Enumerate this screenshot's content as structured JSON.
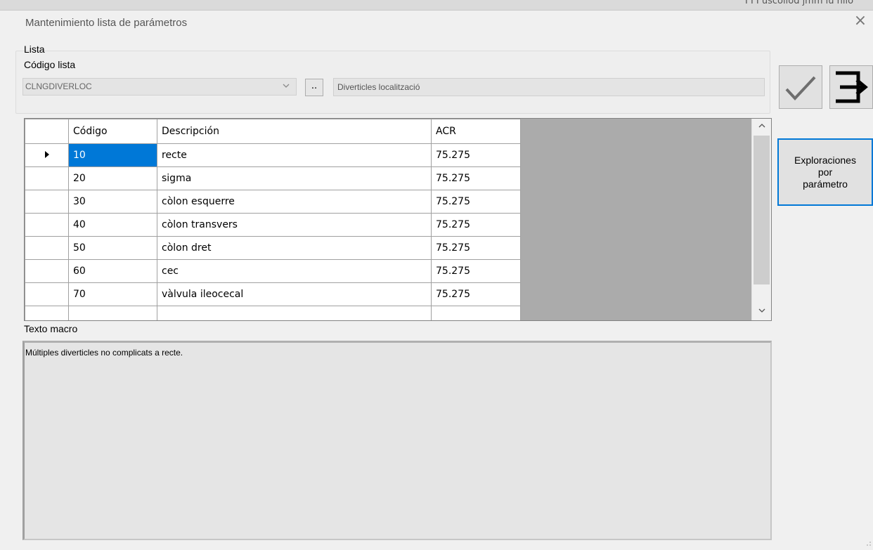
{
  "window": {
    "title": "Mantenimiento lista de parámetros",
    "close_label": "×",
    "background_text": "I I I uscollod jmm lu nilo"
  },
  "lista": {
    "group_label": "Lista",
    "codigo_label": "Código lista",
    "codigo_value": "CLNGDIVERLOC",
    "browse_label": "..",
    "descripcion_value": "Diverticles localització"
  },
  "buttons": {
    "accept_icon": "checkmark-icon",
    "exit_icon": "exit-arrow-icon",
    "exploraciones_line1": "Exploraciones",
    "exploraciones_line2": "por",
    "exploraciones_line3": "parámetro"
  },
  "grid": {
    "headers": [
      "",
      "Código",
      "Descripción",
      "ACR"
    ],
    "rows": [
      {
        "codigo": "10",
        "descripcion": "recte",
        "acr": "75.275"
      },
      {
        "codigo": "20",
        "descripcion": "sigma",
        "acr": "75.275"
      },
      {
        "codigo": "30",
        "descripcion": "còlon esquerre",
        "acr": "75.275"
      },
      {
        "codigo": "40",
        "descripcion": "còlon transvers",
        "acr": "75.275"
      },
      {
        "codigo": "50",
        "descripcion": "còlon dret",
        "acr": "75.275"
      },
      {
        "codigo": "60",
        "descripcion": "cec",
        "acr": "75.275"
      },
      {
        "codigo": "70",
        "descripcion": "vàlvula ileocecal",
        "acr": "75.275"
      }
    ],
    "selected_row": 0
  },
  "macro": {
    "label": "Texto macro",
    "text": "Múltiples diverticles no complicats a recte."
  },
  "colors": {
    "accent": "#0078d7",
    "window_bg": "#f0f0f0"
  }
}
